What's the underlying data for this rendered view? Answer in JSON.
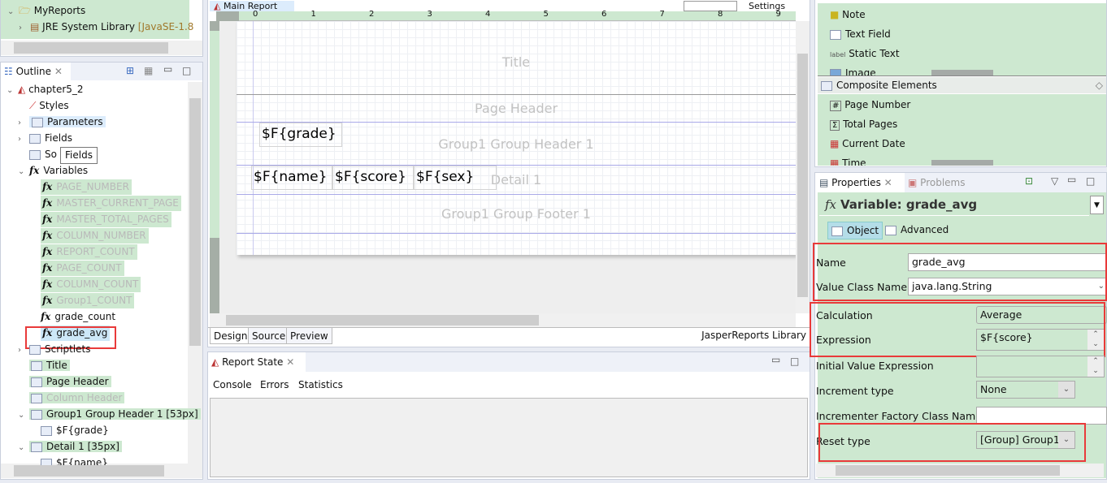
{
  "project": {
    "items": [
      {
        "label": "MyReports"
      },
      {
        "label": "JRE System Library",
        "suffix": "[JavaSE-1.8"
      }
    ]
  },
  "outline": {
    "tab": "Outline",
    "tooltip": "Fields",
    "tree": [
      {
        "label": "chapter5_2"
      },
      {
        "label": "Styles"
      },
      {
        "label": "Parameters"
      },
      {
        "label": "Fields"
      },
      {
        "label": "Sort Fields",
        "visible": "So"
      },
      {
        "label": "Variables"
      },
      {
        "label": "PAGE_NUMBER"
      },
      {
        "label": "MASTER_CURRENT_PAGE"
      },
      {
        "label": "MASTER_TOTAL_PAGES"
      },
      {
        "label": "COLUMN_NUMBER"
      },
      {
        "label": "REPORT_COUNT"
      },
      {
        "label": "PAGE_COUNT"
      },
      {
        "label": "COLUMN_COUNT"
      },
      {
        "label": "Group1_COUNT"
      },
      {
        "label": "grade_count"
      },
      {
        "label": "grade_avg"
      },
      {
        "label": "Scriptlets"
      },
      {
        "label": "Title"
      },
      {
        "label": "Page Header"
      },
      {
        "label": "Column Header"
      },
      {
        "label": "Group1 Group Header 1 [53px]"
      },
      {
        "label": "$F{grade}"
      },
      {
        "label": "Detail 1 [35px]"
      },
      {
        "label": "$F{name}"
      }
    ]
  },
  "editor": {
    "tab": "Main Report",
    "settings": "Settings",
    "ruler": [
      "0",
      "1",
      "2",
      "3",
      "4",
      "5",
      "6",
      "7",
      "8",
      "9"
    ],
    "bands": {
      "title": "Title",
      "page_header": "Page Header",
      "group_header": "Group1 Group Header 1",
      "detail": "Detail 1",
      "group_footer": "Group1 Group Footer 1"
    },
    "fields": {
      "grade": "$F{grade}",
      "name": "$F{name}",
      "score": "$F{score}",
      "sex": "$F{sex}"
    },
    "bottom_tabs": [
      "Design",
      "Source",
      "Preview"
    ],
    "library": "JasperReports Library"
  },
  "report_state": {
    "tab": "Report State",
    "subtabs": [
      "Console",
      "Errors",
      "Statistics"
    ]
  },
  "palette": {
    "items": [
      "Note",
      "Text Field",
      "Static Text",
      "Image"
    ],
    "composite_header": "Composite Elements",
    "composite_items": [
      "Page Number",
      "Total Pages",
      "Current Date",
      "Time"
    ]
  },
  "properties": {
    "tab": "Properties",
    "tab2": "Problems",
    "title": "Variable: grade_avg",
    "subtabs": [
      "Object",
      "Advanced"
    ],
    "name_label": "Name",
    "name_value": "grade_avg",
    "class_label": "Value Class Name",
    "class_value": "java.lang.String",
    "calc_label": "Calculation",
    "calc_value": "Average",
    "expr_label": "Expression",
    "expr_value": "$F{score}",
    "init_label": "Initial Value Expression",
    "init_value": "",
    "incr_label": "Increment type",
    "incr_value": "None",
    "factory_label": "Incrementer Factory Class Name",
    "factory_value": "",
    "reset_label": "Reset type",
    "reset_value": "[Group] Group1"
  },
  "colors": {
    "highlight": "#cde8d0",
    "annotation": "#e93a3a",
    "selection": "#dcecfc"
  }
}
